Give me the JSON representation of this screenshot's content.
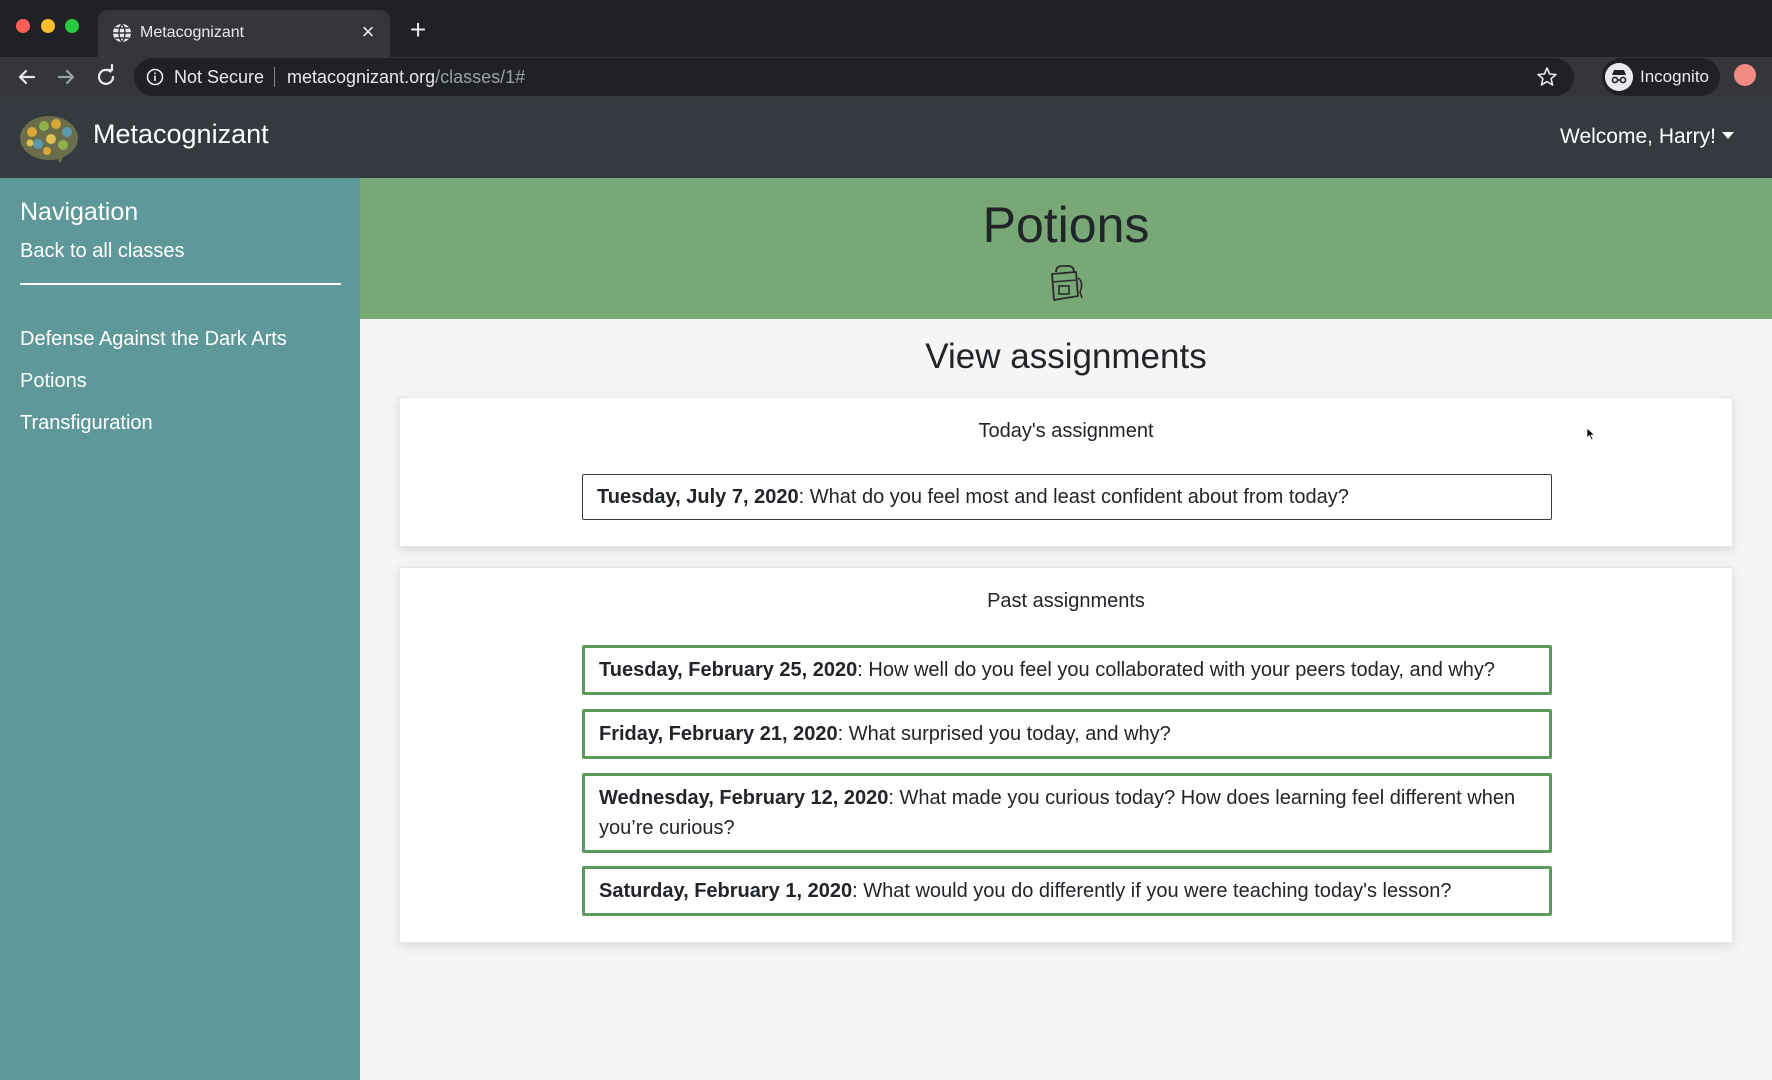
{
  "browser": {
    "tab_title": "Metacognizant",
    "security_label": "Not Secure",
    "url_host": "metacognizant.org",
    "url_path": "/classes/1#",
    "profile_label": "Incognito"
  },
  "navbar": {
    "brand": "Metacognizant",
    "welcome": "Welcome, Harry!"
  },
  "sidebar": {
    "heading": "Navigation",
    "back_link": "Back to all classes",
    "items": [
      {
        "label": "Defense Against the Dark Arts"
      },
      {
        "label": "Potions"
      },
      {
        "label": "Transfiguration"
      }
    ]
  },
  "banner": {
    "class_name": "Potions"
  },
  "main": {
    "title": "View assignments",
    "today": {
      "heading": "Today's assignment",
      "date": "Tuesday, July 7, 2020",
      "prompt": "What do you feel most and least confident about from today?"
    },
    "past": {
      "heading": "Past assignments",
      "items": [
        {
          "date": "Tuesday, February 25, 2020",
          "prompt": "How well do you feel you collaborated with your peers today, and why?"
        },
        {
          "date": "Friday, February 21, 2020",
          "prompt": "What surprised you today, and why?"
        },
        {
          "date": "Wednesday, February 12, 2020",
          "prompt": "What made you curious today? How does learning feel different when you’re curious?"
        },
        {
          "date": "Saturday, February 1, 2020",
          "prompt": "What would you do differently if you were teaching today's lesson?"
        }
      ]
    }
  },
  "colors": {
    "navbar": "#343a40",
    "sidebar": "#5e9898",
    "banner": "#79a877",
    "assignment_border": "#5c9a5c"
  }
}
